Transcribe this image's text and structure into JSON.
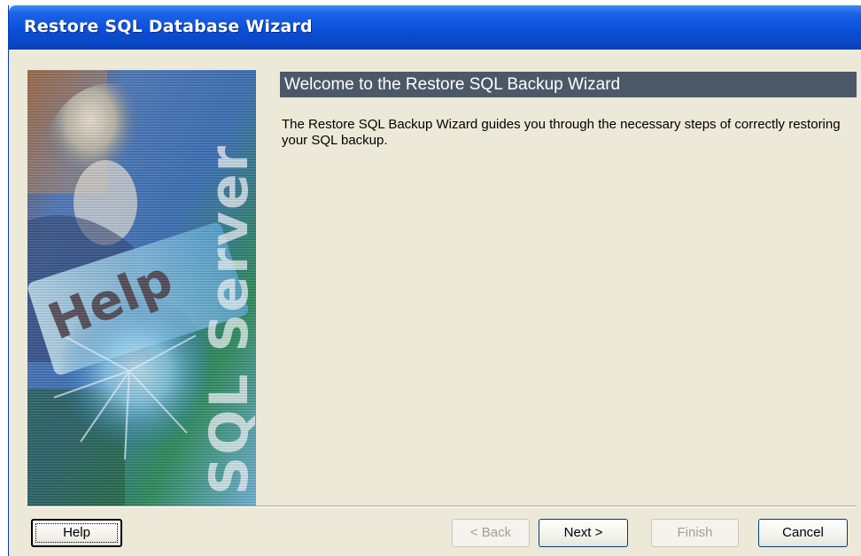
{
  "window": {
    "title": "Restore SQL Database Wizard"
  },
  "sidebar": {
    "image_text_primary": "Help",
    "image_text_secondary": "SQL Server"
  },
  "content": {
    "heading": "Welcome to the Restore SQL Backup Wizard",
    "description": "The Restore SQL Backup Wizard guides you through the necessary steps of correctly restoring your SQL backup."
  },
  "buttons": {
    "help": "Help",
    "back": "< Back",
    "next": "Next >",
    "finish": "Finish",
    "cancel": "Cancel"
  },
  "colors": {
    "titlebar": "#0a4fd8",
    "dialog_bg": "#ece9d8",
    "banner_bg": "#4c5868"
  }
}
